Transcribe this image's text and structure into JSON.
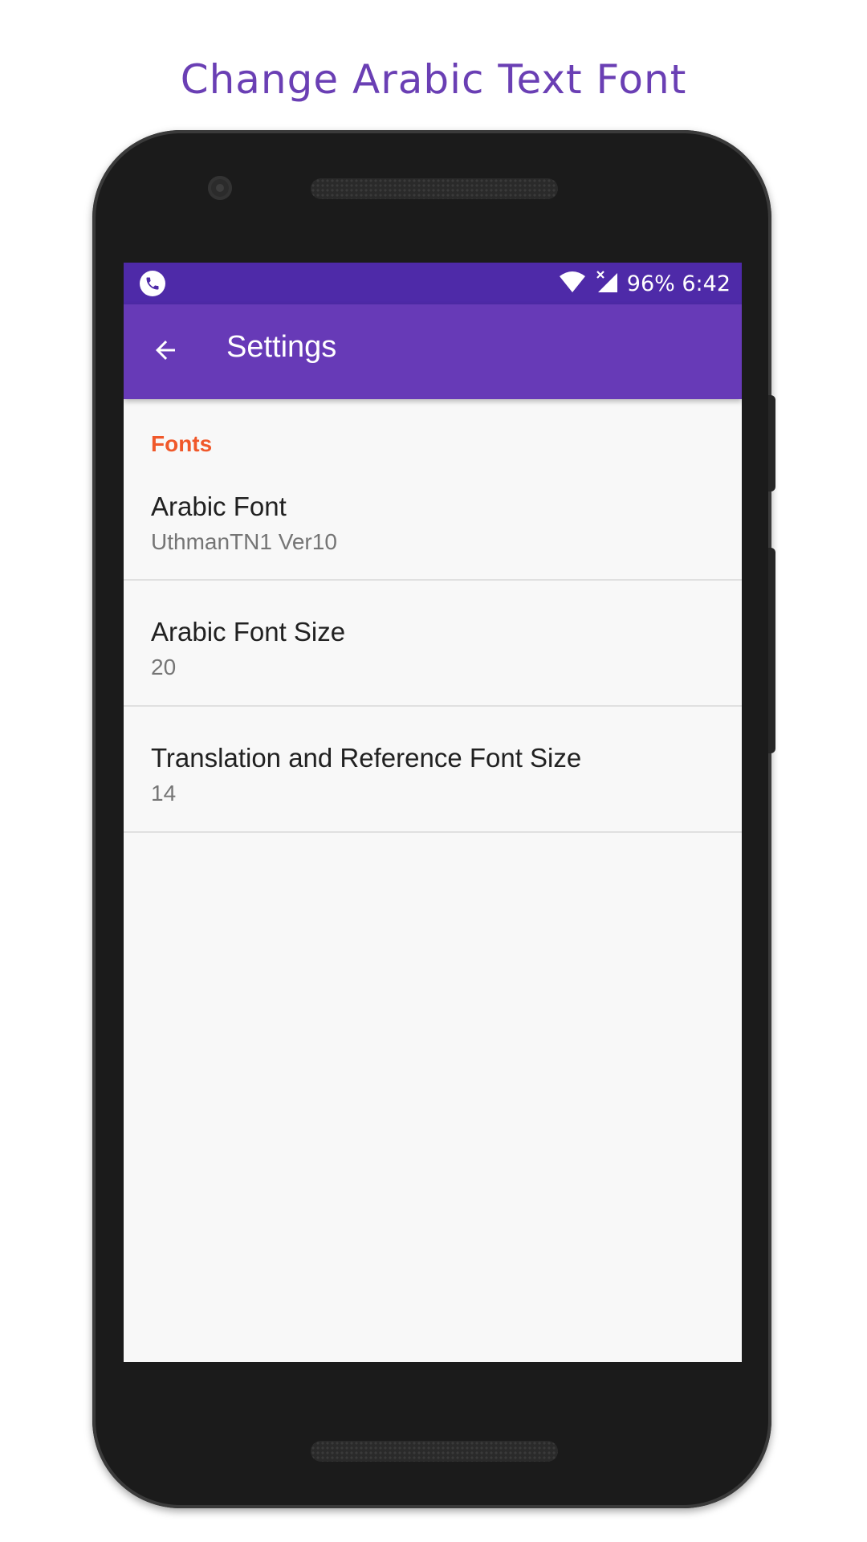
{
  "promo": {
    "headline": "Change Arabic Text Font"
  },
  "status_bar": {
    "left_icon": "phone-call-icon",
    "wifi_icon": "wifi-icon",
    "signal_icon": "signal-no-service-icon",
    "battery_time": "96% 6:42"
  },
  "app_bar": {
    "back_icon": "arrow-back-icon",
    "title": "Settings",
    "color": "#673ab7",
    "status_color": "#4e2aa8"
  },
  "settings": {
    "category": "Fonts",
    "category_color": "#f0582a",
    "items": [
      {
        "title": "Arabic Font",
        "summary": "UthmanTN1 Ver10"
      },
      {
        "title": "Arabic Font Size",
        "summary": "20"
      },
      {
        "title": "Translation and Reference Font Size",
        "summary": "14"
      }
    ]
  }
}
